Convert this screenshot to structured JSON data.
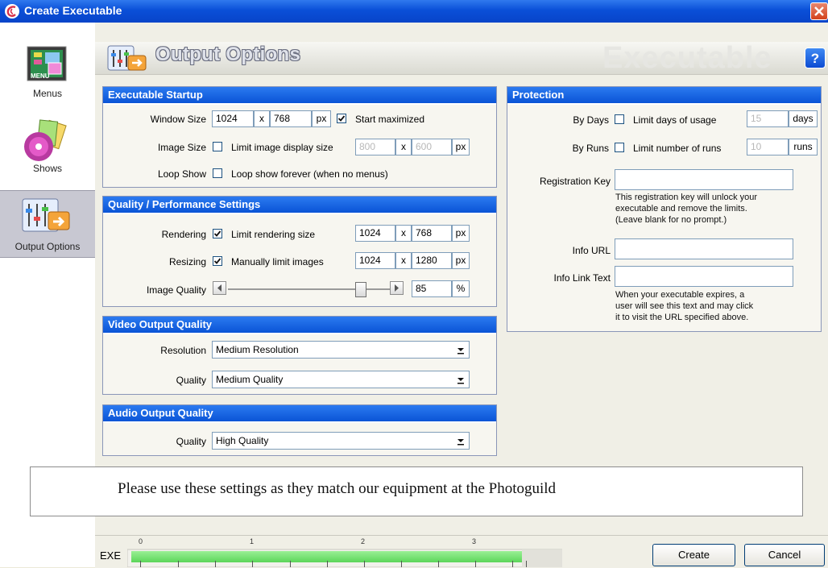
{
  "window": {
    "title": "Create Executable"
  },
  "sidebar": {
    "items": [
      {
        "label": "Menus"
      },
      {
        "label": "Shows"
      },
      {
        "label": "Output Options"
      }
    ]
  },
  "header": {
    "title": "Output Options",
    "watermark": "Executable",
    "help": "?"
  },
  "startup": {
    "heading": "Executable Startup",
    "window_size_label": "Window Size",
    "window_w": "1024",
    "window_h": "768",
    "unit": "px",
    "x": "x",
    "start_maximized_label": "Start maximized",
    "start_maximized": true,
    "image_size_label": "Image Size",
    "limit_display_label": "Limit image display size",
    "limit_display": false,
    "image_w": "800",
    "image_h": "600",
    "loop_label": "Loop Show",
    "loop_forever_label": "Loop show forever (when no menus)",
    "loop_forever": false
  },
  "quality": {
    "heading": "Quality / Performance Settings",
    "rendering_label": "Rendering",
    "limit_rendering_label": "Limit rendering size",
    "limit_rendering": true,
    "render_w": "1024",
    "render_h": "768",
    "resizing_label": "Resizing",
    "manual_limit_label": "Manually limit images",
    "manual_limit": true,
    "resize_w": "1024",
    "resize_h": "1280",
    "image_quality_label": "Image Quality",
    "image_quality": "85",
    "percent": "%",
    "slider_min": 0,
    "slider_max": 100
  },
  "video": {
    "heading": "Video Output Quality",
    "resolution_label": "Resolution",
    "resolution": "Medium Resolution",
    "quality_label": "Quality",
    "quality": "Medium Quality"
  },
  "audio": {
    "heading": "Audio Output Quality",
    "quality_label": "Quality",
    "quality": "High Quality"
  },
  "protection": {
    "heading": "Protection",
    "by_days_label": "By Days",
    "limit_days_label": "Limit days of usage",
    "limit_days": false,
    "days": "15",
    "days_unit": "days",
    "by_runs_label": "By Runs",
    "limit_runs_label": "Limit number of runs",
    "limit_runs": false,
    "runs": "10",
    "runs_unit": "runs",
    "reg_key_label": "Registration Key",
    "reg_key": "",
    "reg_note_1": "This registration key will unlock your",
    "reg_note_2": "executable and remove the limits.",
    "reg_note_3": "(Leave blank for no prompt.)",
    "info_url_label": "Info URL",
    "info_url": "",
    "info_link_label": "Info Link Text",
    "info_link": "",
    "link_note_1": "When your executable expires, a",
    "link_note_2": "user will see this text and may click",
    "link_note_3": "it to visit the URL specified above."
  },
  "note": "Please use these settings as they match our equipment at the Photoguild",
  "footer": {
    "exe_label": "EXE",
    "ticks": [
      "0",
      "1",
      "2",
      "3"
    ],
    "progress_fraction": 0.9,
    "create_label": "Create",
    "cancel_label": "Cancel"
  }
}
